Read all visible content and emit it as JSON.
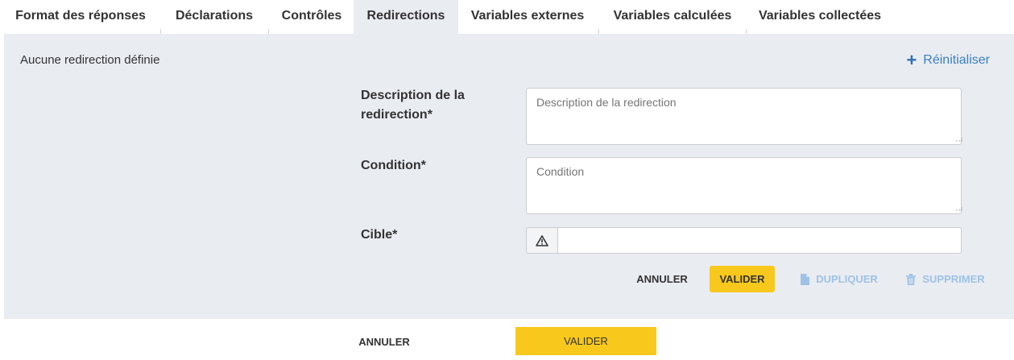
{
  "tabs": [
    {
      "label": "Format des réponses"
    },
    {
      "label": "Déclarations"
    },
    {
      "label": "Contrôles"
    },
    {
      "label": "Redirections",
      "active": true
    },
    {
      "label": "Variables externes"
    },
    {
      "label": "Variables calculées"
    },
    {
      "label": "Variables collectées"
    }
  ],
  "panel": {
    "empty_message": "Aucune redirection définie",
    "reset_label": "Réinitialiser",
    "form": {
      "description_label_line1": "Description de la",
      "description_label_line2": "redirection*",
      "description_placeholder": "Description de la redirection",
      "condition_label": "Condition*",
      "condition_placeholder": "Condition",
      "cible_label": "Cible*",
      "cible_value": ""
    },
    "actions": {
      "cancel": "ANNULER",
      "validate": "VALIDER",
      "duplicate": "DUPLIQUER",
      "delete": "SUPPRIMER"
    }
  },
  "footer": {
    "cancel": "ANNULER",
    "validate": "VALIDER"
  },
  "colors": {
    "panel_bg": "#e9ecf1",
    "accent_yellow": "#f8c81c",
    "link_blue": "#3a7fc1",
    "disabled_blue": "#9ec2e6"
  }
}
